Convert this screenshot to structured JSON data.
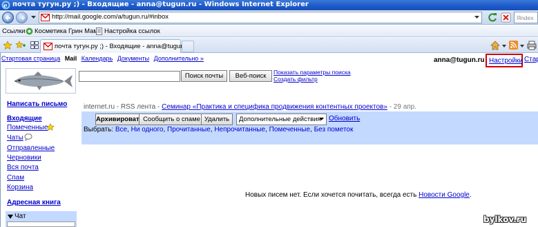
{
  "browser": {
    "title": "почта тугун.ру ;) - Входящие - anna@tugun.ru - Windows Internet Explorer",
    "url": "http://mail.google.com/a/tugun.ru/#inbox",
    "search_placeholder": "Яndex",
    "links_label": "Ссылки",
    "favorites": [
      "Косметика Грин Мама",
      "Настройка ссылок"
    ],
    "tab_title": "почта тугун.ру ;) - Входящие - anna@tugun.ru"
  },
  "gmail": {
    "topnav": {
      "start": "Стартовая страница",
      "mail": "Mail",
      "calendar": "Календарь",
      "docs": "Документы",
      "more": "Дополнительно »"
    },
    "user": "anna@tugun.ru",
    "settings": "Настройки",
    "old_link": "Стар",
    "search": {
      "mail_button": "Поиск почты",
      "web_button": "Веб-поиск",
      "show_options": "Показать параметры поиска",
      "create_filter": "Создать фильтр"
    },
    "sidebar": {
      "compose": "Написать письмо",
      "inbox": "Входящие",
      "starred": "Помеченные",
      "chats": "Чаты",
      "sent": "Отправленные",
      "drafts": "Черновики",
      "all": "Вся почта",
      "spam": "Спам",
      "trash": "Корзина",
      "contacts": "Адресная книга",
      "chat_header": "Чат"
    },
    "rss": {
      "source": "internet.ru - RSS лента - ",
      "title": "Семинар «Практика и специфика продвижения контентных проектов»",
      "date": " - 29 апр."
    },
    "toolbar": {
      "archive": "Архивировать",
      "report_spam": "Сообщить о спаме",
      "delete": "Удалить",
      "more_actions": "Дополнительные действия",
      "refresh": "Обновить"
    },
    "select": {
      "label": "Выбрать: ",
      "all": "Все",
      "none": "Ни одного",
      "read": "Прочитанные",
      "unread": "Непрочитанные",
      "starred": "Помеченные",
      "unstarred": "Без пометок"
    },
    "empty": {
      "text": "Новых писем нет. Если хочется почитать, всегда есть ",
      "link": "Новости Google",
      "end": "."
    }
  },
  "watermark": "bylkov.ru",
  "colors": {
    "gmail_blue": "#c3d9ff",
    "link": "#0000cc",
    "highlight": "#d00000"
  }
}
